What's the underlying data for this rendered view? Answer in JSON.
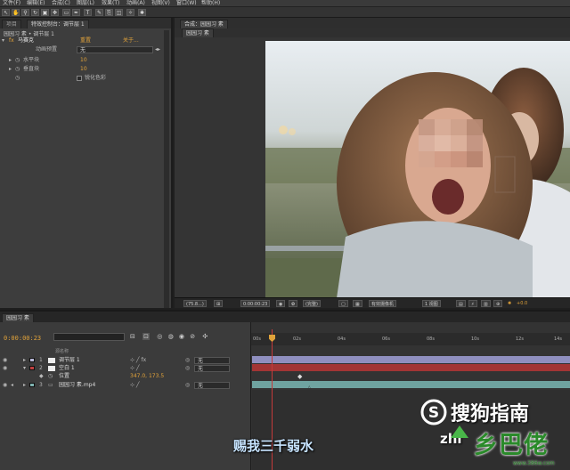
{
  "menubar": {
    "items": [
      "文件(F)",
      "编辑(E)",
      "合成(C)",
      "图层(L)",
      "效果(T)",
      "动画(A)",
      "视图(V)",
      "窗口(W)",
      "帮助(H)"
    ]
  },
  "left_panel": {
    "tabs": [
      "项目",
      "特效控制台：调节层 1"
    ],
    "breadcrumb": "园园习 素 • 调节层 1",
    "effect": {
      "name": "马赛克",
      "reset": "重置",
      "about": "关于..."
    },
    "props": [
      {
        "label": "动画预置",
        "value": "无"
      },
      {
        "label": "水平块",
        "value": "10"
      },
      {
        "label": "垂直块",
        "value": "10"
      },
      {
        "label": "",
        "value": "锐化色彩"
      }
    ]
  },
  "comp_panel": {
    "tab_prefix": "合成：",
    "tab": "园园习 素",
    "subtab": "园园习 素",
    "footer": {
      "zoom": "(75.8...)",
      "timecode": "0:00:00:23",
      "resolution": "(完整)",
      "camera": "有效摄像机",
      "views": "1 视图",
      "exposure": "+0.0"
    }
  },
  "timeline": {
    "tab": "园园习 素",
    "timecode": "0:00:00:23",
    "columns": [
      "源名称"
    ],
    "ruler": [
      "00s",
      "02s",
      "04s",
      "06s",
      "08s",
      "10s",
      "12s",
      "14s"
    ],
    "layers": [
      {
        "num": "1",
        "name": "调节层 1",
        "color": "#b9b9d8",
        "parent": "无"
      },
      {
        "num": "2",
        "name": "空白 1",
        "color": "#c04040",
        "parent": "无"
      },
      {
        "num": "",
        "name": "位置",
        "value": "347.0, 173.5"
      },
      {
        "num": "3",
        "name": "园园习 素.mp4",
        "color": "#7fb3b0",
        "parent": "无"
      }
    ]
  },
  "overlays": {
    "subtitle": "赐我三千弱水",
    "sogou": "搜狗指南",
    "zhi": "zhi",
    "watermark": "乡巴佬",
    "watermark_url": "www.386w.com"
  }
}
